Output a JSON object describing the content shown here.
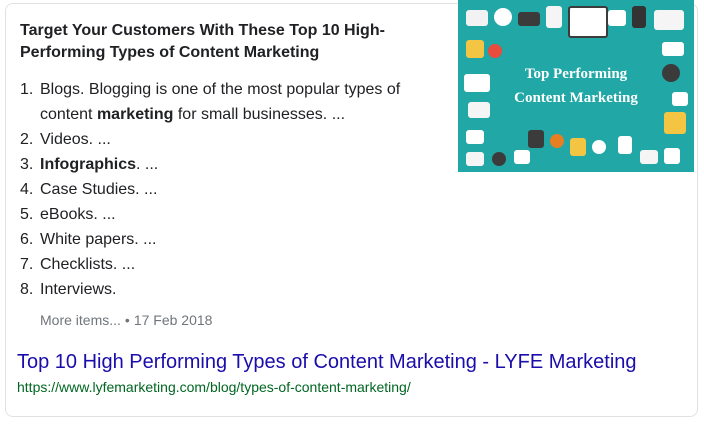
{
  "snippet": {
    "title": "Target Your Customers With These Top 10 High-Performing Types of Content Marketing",
    "items": [
      {
        "num": "1.",
        "parts": [
          {
            "text": "Blogs. Blogging is one of the most popular types of content ",
            "bold": false
          },
          {
            "text": "marketing",
            "bold": true
          },
          {
            "text": " for small businesses. ...",
            "bold": false
          }
        ]
      },
      {
        "num": "2.",
        "parts": [
          {
            "text": "Videos. ...",
            "bold": false
          }
        ]
      },
      {
        "num": "3.",
        "parts": [
          {
            "text": "Infographics",
            "bold": true
          },
          {
            "text": ". ...",
            "bold": false
          }
        ]
      },
      {
        "num": "4.",
        "parts": [
          {
            "text": "Case Studies. ...",
            "bold": false
          }
        ]
      },
      {
        "num": "5.",
        "parts": [
          {
            "text": "eBooks. ...",
            "bold": false
          }
        ]
      },
      {
        "num": "6.",
        "parts": [
          {
            "text": "White papers. ...",
            "bold": false
          }
        ]
      },
      {
        "num": "7.",
        "parts": [
          {
            "text": "Checklists. ...",
            "bold": false
          }
        ]
      },
      {
        "num": "8.",
        "parts": [
          {
            "text": "Interviews.",
            "bold": false
          }
        ]
      }
    ],
    "more_items": "More items...",
    "separator": "•",
    "date": "17 Feb 2018"
  },
  "result": {
    "link_title": "Top 10 High Performing Types of Content Marketing - LYFE Marketing",
    "url": "https://www.lyfemarketing.com/blog/types-of-content-marketing/"
  },
  "thumbnail": {
    "caption_line1": "Top Performing",
    "caption_line2": "Content Marketing",
    "background": "#20a7a6"
  },
  "colors": {
    "link": "#1a0dab",
    "url": "#006621",
    "meta": "#70757a"
  }
}
